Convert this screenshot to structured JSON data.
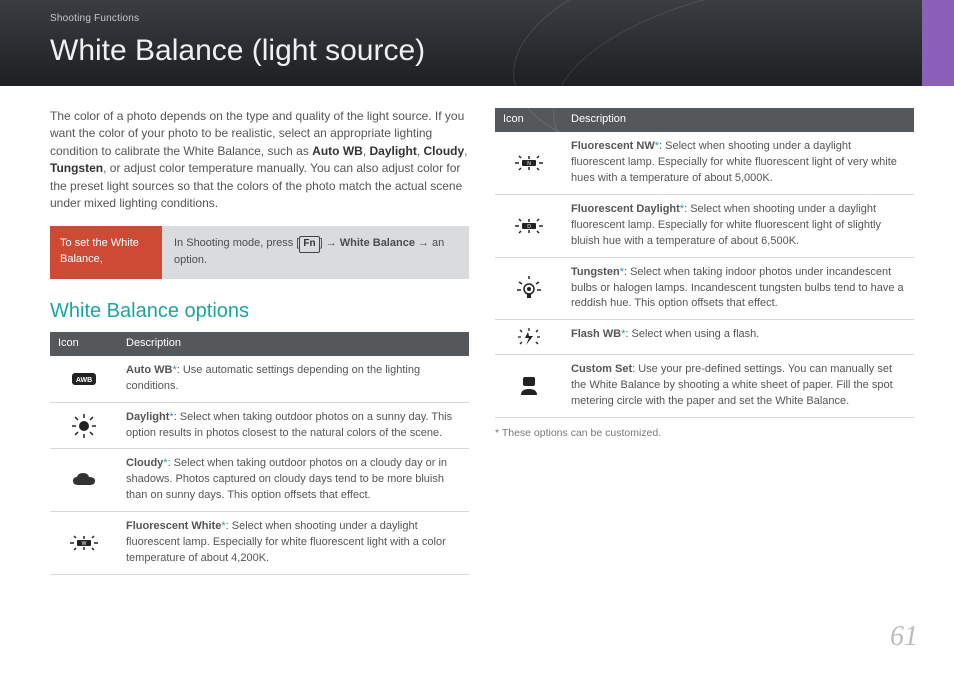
{
  "header": {
    "section": "Shooting Functions",
    "title": "White Balance (light source)"
  },
  "intro": {
    "pre": "The color of a photo depends on the type and quality of the light source. If you want the color of your photo to be realistic, select an appropriate lighting condition to calibrate the White Balance, such as ",
    "bold1": "Auto WB",
    "bold2": "Daylight",
    "bold3": "Cloudy",
    "bold4": "Tungsten",
    "sep": ", ",
    "post": ", or adjust color temperature manually. You can also adjust color for the preset light sources so that the colors of the photo match the actual scene under mixed lighting conditions."
  },
  "note": {
    "label": "To set the White Balance,",
    "body_pre": "In Shooting mode, press [",
    "key": "Fn",
    "body_mid": "] → ",
    "bold": "White Balance",
    "body_post": " → an option."
  },
  "options_heading": "White Balance options",
  "table_headers": {
    "icon": "Icon",
    "desc": "Description"
  },
  "left": [
    {
      "name": "Auto WB",
      "star": "*",
      "desc": ": Use automatic settings depending on the lighting conditions."
    },
    {
      "name": "Daylight",
      "star": "*",
      "desc": ": Select when taking outdoor photos on a sunny day. This option results in photos closest to the natural colors of the scene."
    },
    {
      "name": "Cloudy",
      "star": "*",
      "desc": ": Select when taking outdoor photos on a cloudy day or in shadows. Photos captured on cloudy days tend to be more bluish than on sunny days. This option offsets that effect."
    },
    {
      "name": "Fluorescent White",
      "star": "*",
      "desc": ": Select when shooting under a daylight fluorescent lamp. Especially for white fluorescent light with a color temperature of about 4,200K."
    }
  ],
  "right": [
    {
      "name": "Fluorescent NW",
      "star": "*",
      "desc": ": Select when shooting under a daylight fluorescent lamp. Especially for white fluorescent light of very white hues with a temperature of about 5,000K."
    },
    {
      "name": "Fluorescent Daylight",
      "star": "*",
      "desc": ": Select when shooting under a daylight fluorescent lamp. Especially for white fluorescent light of slightly bluish hue with a temperature of about 6,500K."
    },
    {
      "name": "Tungsten",
      "star": "*",
      "desc": ": Select when taking indoor photos under incandescent bulbs or halogen lamps. Incandescent tungsten bulbs tend to have a reddish hue. This option offsets that effect."
    },
    {
      "name": "Flash WB",
      "star": "*",
      "desc": ": Select when using a flash."
    },
    {
      "name": "Custom Set",
      "desc": ": Use your pre-defined settings. You can manually set the White Balance by shooting a white sheet of paper. Fill the spot metering circle with the paper and set the White Balance."
    }
  ],
  "footnote": "* These options can be customized.",
  "page_number": "61"
}
